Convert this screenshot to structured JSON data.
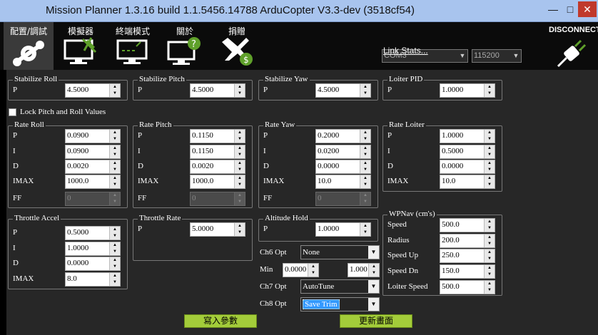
{
  "window": {
    "title": "Mission Planner 1.3.16 build 1.1.5456.14788 ArduCopter V3.3-dev (3518cf54)",
    "min": "—",
    "max": "□",
    "close": "✕"
  },
  "menu": {
    "items": [
      {
        "label": "配置/調試",
        "icon": "wrench-icon"
      },
      {
        "label": "模擬器",
        "icon": "simulator-monitor-icon"
      },
      {
        "label": "終端模式",
        "icon": "terminal-monitor-icon"
      },
      {
        "label": "關於",
        "icon": "help-monitor-icon"
      },
      {
        "label": "捐贈",
        "icon": "donate-plane-icon"
      }
    ]
  },
  "connection": {
    "port": "COM3",
    "baud": "115200",
    "link_stats": "Link Stats...",
    "disconnect": "DISCONNECT"
  },
  "groups": {
    "stab_roll": {
      "title": "Stabilize Roll",
      "p_label": "P",
      "p": "4.5000"
    },
    "stab_pitch": {
      "title": "Stabilize Pitch",
      "p_label": "P",
      "p": "4.5000"
    },
    "stab_yaw": {
      "title": "Stabilize Yaw",
      "p_label": "P",
      "p": "4.5000"
    },
    "loiter_pid": {
      "title": "Loiter PID",
      "p_label": "P",
      "p": "1.0000"
    },
    "lock": {
      "label": "Lock Pitch and Roll Values"
    },
    "rate_roll": {
      "title": "Rate Roll",
      "rows": [
        {
          "l": "P",
          "v": "0.0900"
        },
        {
          "l": "I",
          "v": "0.0900"
        },
        {
          "l": "D",
          "v": "0.0020"
        },
        {
          "l": "IMAX",
          "v": "1000.0"
        },
        {
          "l": "FF",
          "v": "0"
        }
      ]
    },
    "rate_pitch": {
      "title": "Rate Pitch",
      "rows": [
        {
          "l": "P",
          "v": "0.1150"
        },
        {
          "l": "I",
          "v": "0.1150"
        },
        {
          "l": "D",
          "v": "0.0020"
        },
        {
          "l": "IMAX",
          "v": "1000.0"
        },
        {
          "l": "FF",
          "v": "0"
        }
      ]
    },
    "rate_yaw": {
      "title": "Rate Yaw",
      "rows": [
        {
          "l": "P",
          "v": "0.2000"
        },
        {
          "l": "I",
          "v": "0.0200"
        },
        {
          "l": "D",
          "v": "0.0000"
        },
        {
          "l": "IMAX",
          "v": "10.0"
        },
        {
          "l": "FF",
          "v": "0"
        }
      ]
    },
    "rate_loiter": {
      "title": "Rate Loiter",
      "rows": [
        {
          "l": "P",
          "v": "1.0000"
        },
        {
          "l": "I",
          "v": "0.5000"
        },
        {
          "l": "D",
          "v": "0.0000"
        },
        {
          "l": "IMAX",
          "v": "10.0"
        }
      ]
    },
    "throttle_accel": {
      "title": "Throttle Accel",
      "rows": [
        {
          "l": "P",
          "v": "0.5000"
        },
        {
          "l": "I",
          "v": "1.0000"
        },
        {
          "l": "D",
          "v": "0.0000"
        },
        {
          "l": "IMAX",
          "v": "8.0"
        }
      ]
    },
    "throttle_rate": {
      "title": "Throttle Rate",
      "p_label": "P",
      "p": "5.0000"
    },
    "altitude_hold": {
      "title": "Altitude Hold",
      "p_label": "P",
      "p": "1.0000"
    },
    "wpnav": {
      "title": "WPNav (cm's)",
      "rows": [
        {
          "l": "Speed",
          "v": "500.0"
        },
        {
          "l": "Radius",
          "v": "200.0"
        },
        {
          "l": "Speed Up",
          "v": "250.0"
        },
        {
          "l": "Speed Dn",
          "v": "150.0"
        },
        {
          "l": "Loiter Speed",
          "v": "500.0"
        }
      ]
    }
  },
  "options": {
    "ch6_label": "Ch6 Opt",
    "ch6": "None",
    "min_label": "Min",
    "min": "0.0000",
    "max": "1.000",
    "ch7_label": "Ch7 Opt",
    "ch7": "AutoTune",
    "ch8_label": "Ch8 Opt",
    "ch8": "Save Trim"
  },
  "buttons": {
    "write": "寫入參數",
    "refresh": "更新畫面"
  }
}
